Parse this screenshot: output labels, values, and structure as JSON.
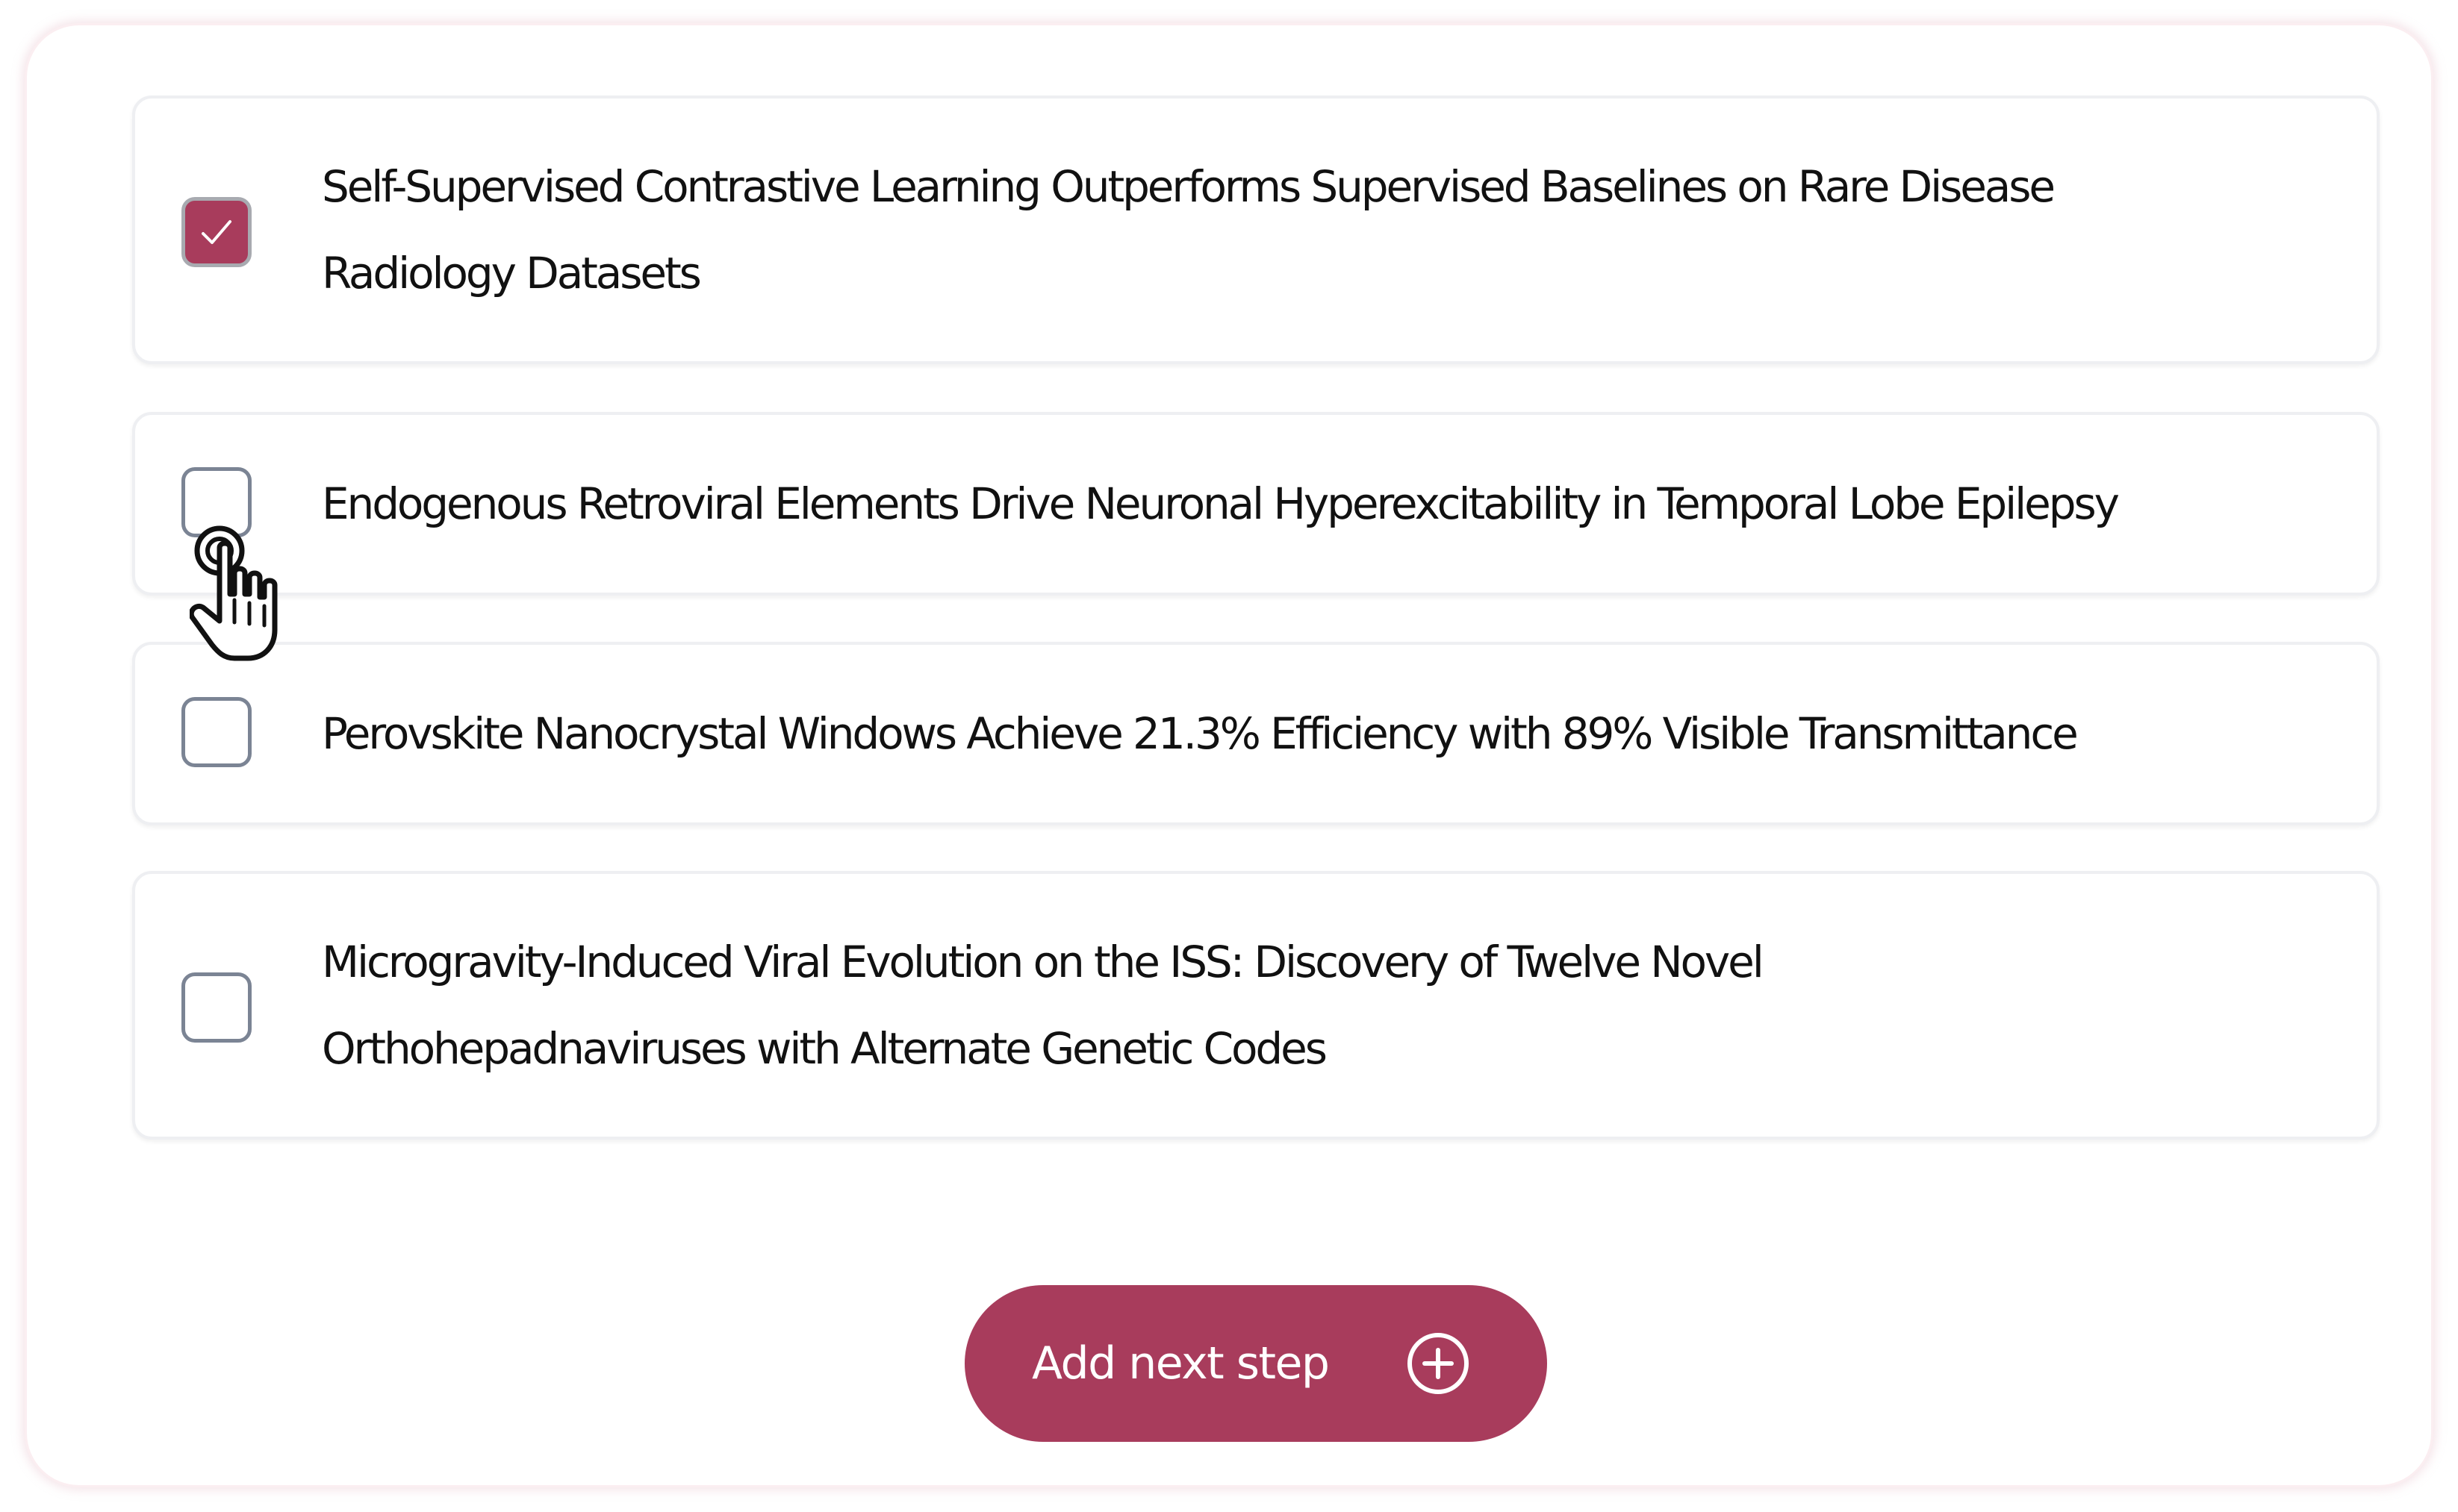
{
  "papers": [
    {
      "line1": "Self-Supervised Contrastive Learning Outperforms Supervised Baselines on Rare Disease",
      "line2": "Radiology Datasets",
      "checked": true
    },
    {
      "line1": "Endogenous Retroviral Elements Drive Neuronal Hyperexcitability in Temporal Lobe Epilepsy",
      "checked": false
    },
    {
      "line1": "Perovskite Nanocrystal Windows Achieve 21.3% Efficiency with 89% Visible Transmittance",
      "checked": false
    },
    {
      "line1": "Microgravity-Induced Viral Evolution on the ISS: Discovery of Twelve Novel",
      "line2": "Orthohepadnaviruses with Alternate Genetic Codes",
      "checked": false
    }
  ],
  "add_button": {
    "label": "Add next step",
    "icon": "plus-circle-icon"
  },
  "cursor": {
    "icon": "pointer-hand-icon"
  },
  "colors": {
    "accent": "#a83c5c",
    "checkbox_border": "#7b8494",
    "card_border": "#eeeff2",
    "text": "#111111"
  }
}
